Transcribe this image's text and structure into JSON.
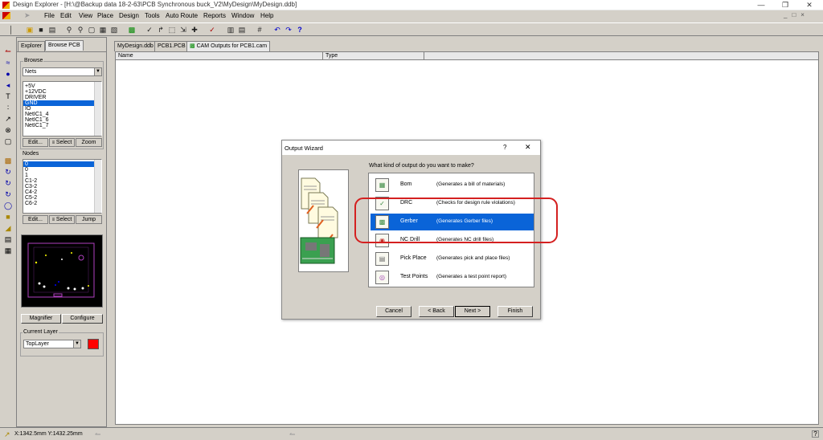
{
  "window": {
    "title": "Design Explorer - [H:\\@Backup data 18-2-63\\PCB Synchronous buck_V2\\MyDesign\\MyDesign.ddb]"
  },
  "menu": [
    "File",
    "Edit",
    "View",
    "Place",
    "Design",
    "Tools",
    "Auto Route",
    "Reports",
    "Window",
    "Help"
  ],
  "panel": {
    "tabs": [
      "Explorer",
      "Browse PCB"
    ],
    "browse_label": "Browse",
    "browse_select": "Nets",
    "nets": [
      "+5V",
      "+12VDC",
      "DRIVER",
      "GND",
      "IO",
      "NetIC1_4",
      "NetIC1_6",
      "NetIC1_7"
    ],
    "selected_net": "GND",
    "net_buttons": [
      "Edit...",
      "Select",
      "Zoom"
    ],
    "nodes_label": "Nodes",
    "nodes": [
      "0",
      "0",
      "1",
      "C1-2",
      "C3-2",
      "C4-2",
      "C5-2",
      "C6-2"
    ],
    "node_buttons": [
      "Edit...",
      "Select",
      "Jump"
    ],
    "magnifier": "Magnifier",
    "configure": "Configure",
    "current_layer_label": "Current Layer",
    "current_layer": "TopLayer",
    "layer_color": "#ff0000"
  },
  "doc_tabs": [
    "MyDesign.ddb",
    "PCB1.PCB",
    "CAM Outputs for PCB1.cam"
  ],
  "columns": [
    "Name",
    "Type"
  ],
  "dialog": {
    "title": "Output Wizard",
    "help": "?",
    "close": "✕",
    "question": "What kind of output do you want to make?",
    "options": [
      {
        "name": "Bom",
        "desc": "(Generates a bill of materials)"
      },
      {
        "name": "DRC",
        "desc": "(Checks for design rule violations)"
      },
      {
        "name": "Gerber",
        "desc": "(Generates Gerber files)"
      },
      {
        "name": "NC Drill",
        "desc": "(Generates NC drill files)"
      },
      {
        "name": "Pick Place",
        "desc": "(Generates pick and place files)"
      },
      {
        "name": "Test Points",
        "desc": "(Generates a test point report)"
      }
    ],
    "selected": "Gerber",
    "buttons": {
      "cancel": "Cancel",
      "back": "< Back",
      "next": "Next >",
      "finish": "Finish"
    }
  },
  "status": {
    "coords": "X:1342.5mm Y:1432.25mm"
  },
  "accent": "#0a64d8",
  "highlight_color": "#d42020"
}
